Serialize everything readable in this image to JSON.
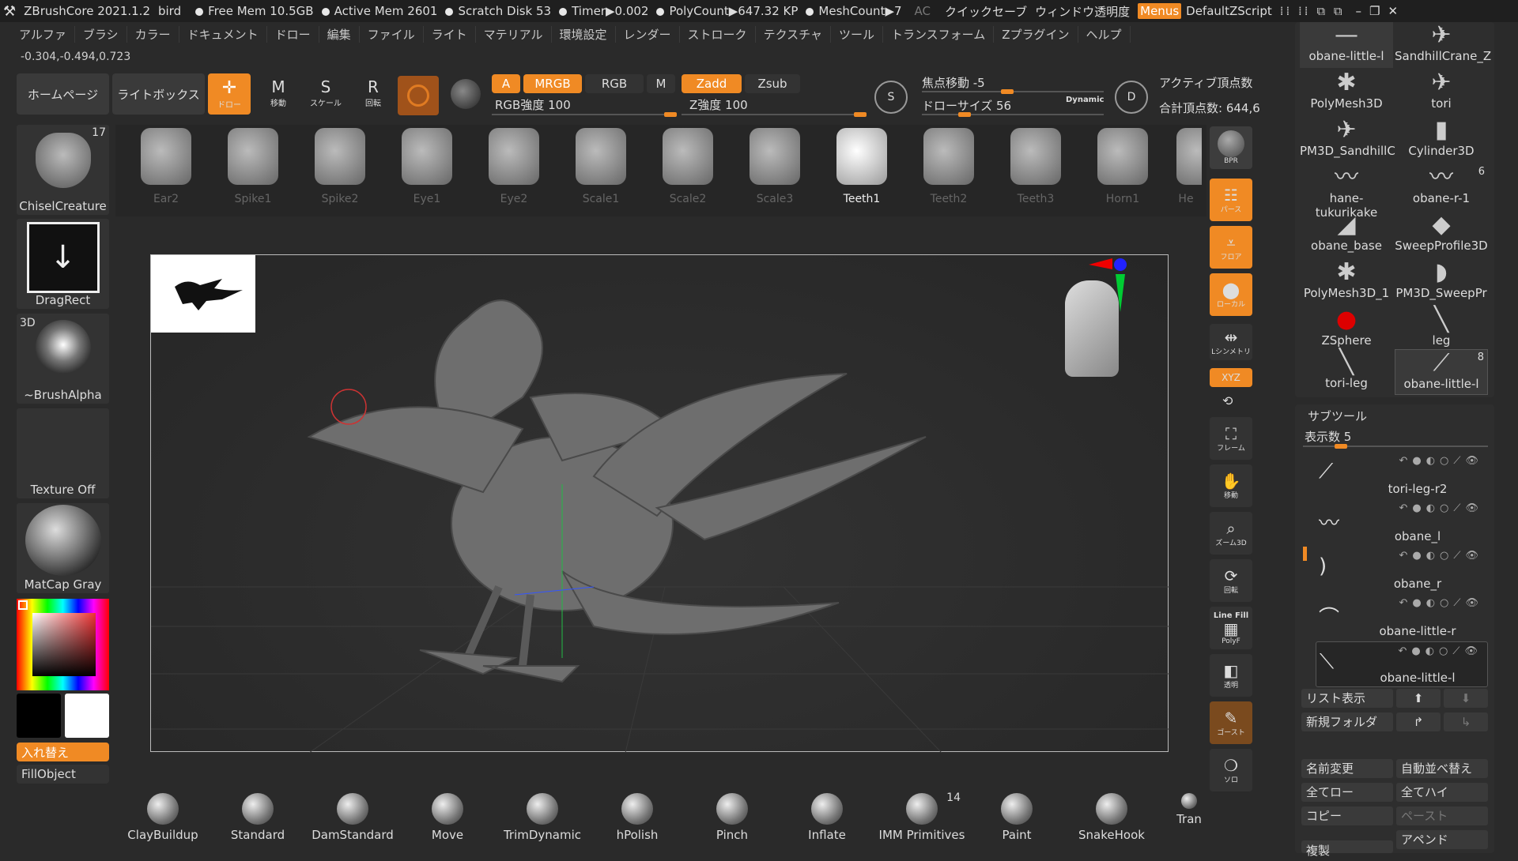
{
  "titlebar": {
    "app": "ZBrushCore 2021.1.2",
    "doc": "bird",
    "free_mem": "Free Mem 10.5GB",
    "active_mem": "Active Mem 2601",
    "scratch": "Scratch Disk 53",
    "timer": "Timer▶0.002",
    "polycount": "PolyCount▶647.32 KP",
    "meshcount": "MeshCount▶7",
    "ac": "AC",
    "quicksave": "クイックセーブ",
    "transparency": "ウィンドウ透明度",
    "menus": "Menus",
    "script": "DefaultZScript"
  },
  "menubar": [
    "アルファ",
    "ブラシ",
    "カラー",
    "ドキュメント",
    "ドロー",
    "編集",
    "ファイル",
    "ライト",
    "マテリアル",
    "環境設定",
    "レンダー",
    "ストローク",
    "テクスチャ",
    "ツール",
    "トランスフォーム",
    "Zプラグイン",
    "ヘルプ"
  ],
  "coords": "-0.304,-0.494,0.723",
  "top": {
    "home": "ホームページ",
    "lightbox": "ライトボックス",
    "draw": "ドロー",
    "move": "移動",
    "scale": "スケール",
    "rotate": "回転",
    "a": "A",
    "mrgb": "MRGB",
    "rgb": "RGB",
    "m": "M",
    "zadd": "Zadd",
    "zsub": "Zsub",
    "rgb_intensity": "RGB強度 100",
    "rgb_intensity_value": 100,
    "z_intensity": "Z強度 100",
    "z_intensity_value": 100,
    "focal": "焦点移動 -5",
    "focal_value": -5,
    "drawsize": "ドローサイズ 56",
    "drawsize_value": 56,
    "dynamic": "Dynamic",
    "active_pts": "アクティブ頂点数",
    "total_pts": "合計頂点数: 644,6"
  },
  "left": {
    "brush_count": "17",
    "brush": "ChiselCreature",
    "stroke": "DragRect",
    "alpha_tag": "3D",
    "alpha": "~BrushAlpha",
    "texture": "Texture Off",
    "material": "MatCap Gray",
    "swap": "入れ替え",
    "fill": "FillObject"
  },
  "shelf": [
    "Ear2",
    "Spike1",
    "Spike2",
    "Eye1",
    "Eye2",
    "Scale1",
    "Scale2",
    "Scale3",
    "Teeth1",
    "Teeth2",
    "Teeth3",
    "Horn1",
    "He"
  ],
  "shelf_selected": "Teeth1",
  "rightbar": {
    "bpr": "BPR",
    "persp": "パース",
    "floor": "フロア",
    "local": "ローカル",
    "sym": "Lシンメトリ",
    "xyz": "XYZ",
    "frame": "フレーム",
    "move": "移動",
    "zoom3d": "ズーム3D",
    "rotate": "回転",
    "linefill": "Line Fill",
    "polyf": "PolyF",
    "transp": "透明",
    "ghost": "ゴースト",
    "solo": "ソロ"
  },
  "tools": [
    {
      "name": "obane-little-l",
      "glyph": "—"
    },
    {
      "name": "SandhillCrane_Z",
      "glyph": "✈"
    },
    {
      "name": "PolyMesh3D",
      "glyph": "✱"
    },
    {
      "name": "tori",
      "glyph": "✈"
    },
    {
      "name": "PM3D_SandhillC",
      "glyph": "✈"
    },
    {
      "name": "Cylinder3D",
      "glyph": "▮"
    },
    {
      "name": "hane-tukurikake",
      "glyph": "〰"
    },
    {
      "name": "obane-r-1",
      "glyph": "〰"
    },
    {
      "name": "obane_base",
      "glyph": "◢"
    },
    {
      "name": "SweepProfile3D",
      "glyph": "◆"
    },
    {
      "name": "PolyMesh3D_1",
      "glyph": "✱"
    },
    {
      "name": "PM3D_SweepPr",
      "glyph": "◗"
    },
    {
      "name": "ZSphere",
      "glyph": "●"
    },
    {
      "name": "leg",
      "glyph": "╲"
    },
    {
      "name": "tori-leg",
      "glyph": "╲"
    },
    {
      "name": "obane-little-l",
      "glyph": "⟋"
    }
  ],
  "tool_badges": {
    "obane_r1": "6",
    "obane_little": "8"
  },
  "subtool": {
    "title": "サブツール",
    "display": "表示数 5",
    "display_value": 5,
    "items": [
      "tori-leg-r2",
      "obane_l",
      "obane_r",
      "obane-little-r",
      "obane-little-l"
    ],
    "selected": "obane-little-l"
  },
  "subbtns": {
    "list": "リスト表示",
    "newfolder": "新規フォルダ",
    "rename": "名前変更",
    "autosort": "自動並べ替え",
    "alllow": "全てロー",
    "allhigh": "全てハイ",
    "copy": "コピー",
    "paste": "ペースト",
    "append": "アペンド",
    "dup": "複製"
  },
  "brushes": [
    "ClayBuildup",
    "Standard",
    "DamStandard",
    "Move",
    "TrimDynamic",
    "hPolish",
    "Pinch",
    "Inflate",
    "IMM Primitives",
    "Paint",
    "SnakeHook",
    "Tran"
  ],
  "imm_count": "14"
}
